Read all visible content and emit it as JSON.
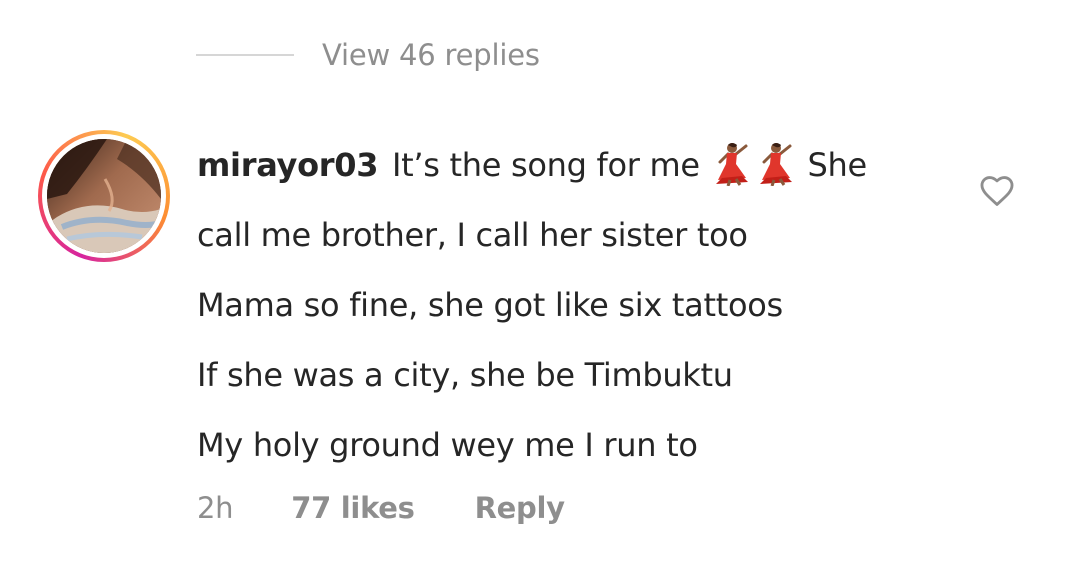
{
  "view_replies": {
    "label": "View 46 replies"
  },
  "comment": {
    "username": "mirayor03",
    "line1_text": "It’s the song for me",
    "line1_tail": "She",
    "line2": "call me brother, I call her sister too",
    "line3": "Mama so fine, she got like six tattoos",
    "line4": "If she was a city, she be Timbuktu",
    "line5": "My holy ground wey me I run to",
    "emojis": [
      "dancer-icon",
      "dancer-icon"
    ]
  },
  "meta": {
    "time": "2h",
    "likes": "77 likes",
    "reply": "Reply"
  },
  "colors": {
    "text": "#262626",
    "secondary": "#8e8e8e",
    "divider": "#d6d6d6",
    "ring_start": "#d6249f",
    "ring_end": "#fdcb52"
  },
  "icons": {
    "like": "heart-outline-icon"
  }
}
